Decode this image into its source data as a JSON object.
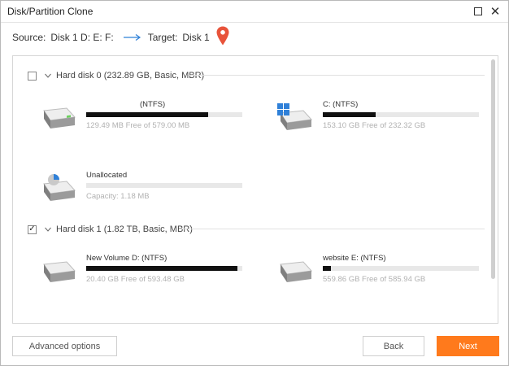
{
  "window": {
    "title": "Disk/Partition Clone",
    "controls": {
      "minimize_icon": "minus-icon",
      "maximize_icon": "square-icon",
      "close_icon": "close-icon"
    }
  },
  "route": {
    "source_label": "Source:",
    "source_value": "Disk 1 D: E: F:",
    "arrow_icon": "arrow-right-icon",
    "target_label": "Target:",
    "target_value": "Disk 1",
    "target_marker_icon": "location-pin-icon"
  },
  "disks": [
    {
      "checked": false,
      "checkbox_glyph": "",
      "label": "Hard disk 0 (232.89 GB, Basic, MBR)",
      "partitions": [
        {
          "name": "(NTFS)",
          "free_text": "129.49 MB Free of 579.00 MB",
          "used_fraction": 0.78,
          "icon": "drive-icon"
        },
        {
          "name": "C: (NTFS)",
          "free_text": "153.10 GB Free of 232.32 GB",
          "used_fraction": 0.34,
          "icon": "windows-drive-icon"
        },
        {
          "name": "Unallocated",
          "free_text": "Capacity: 1.18 MB",
          "used_fraction": 0.0,
          "icon": "unallocated-drive-icon"
        }
      ]
    },
    {
      "checked": true,
      "checkbox_glyph": "✓",
      "label": "Hard disk 1 (1.82 TB, Basic, MBR)",
      "partitions": [
        {
          "name": "New Volume D: (NTFS)",
          "free_text": "20.40 GB Free of 593.48 GB",
          "used_fraction": 0.97,
          "icon": "drive-icon"
        },
        {
          "name": "website E: (NTFS)",
          "free_text": "559.86 GB Free of 585.94 GB",
          "used_fraction": 0.05,
          "icon": "drive-icon"
        }
      ]
    }
  ],
  "footer": {
    "advanced_label": "Advanced options",
    "back_label": "Back",
    "next_label": "Next"
  },
  "colors": {
    "accent": "#ff7a1c",
    "pin": "#e8533a",
    "windows_blue": "#2f80d8",
    "bar_fill": "#111111",
    "bar_track": "#e8e8e8"
  }
}
